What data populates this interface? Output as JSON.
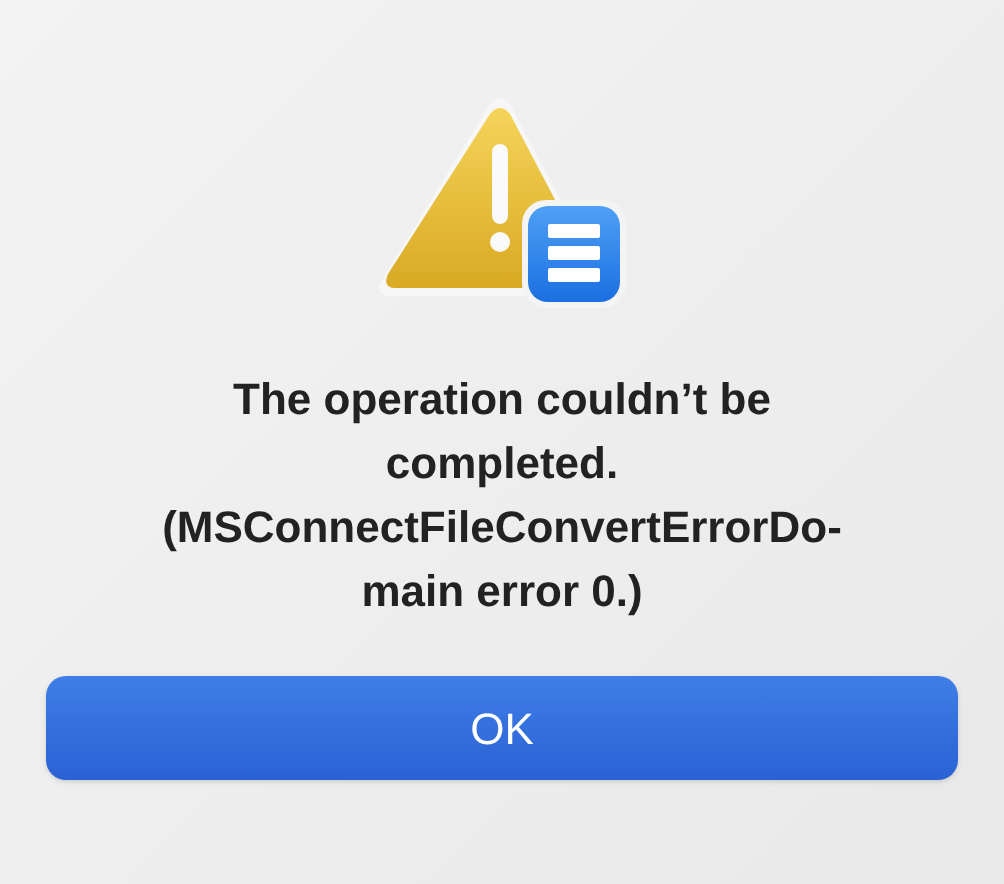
{
  "alert": {
    "message": "The operation couldn’t be\ncompleted.\n(MSConnectFileConvertErrorDo-\nmain error 0.)",
    "buttons": [
      {
        "label": "OK",
        "kind": "default"
      }
    ]
  }
}
